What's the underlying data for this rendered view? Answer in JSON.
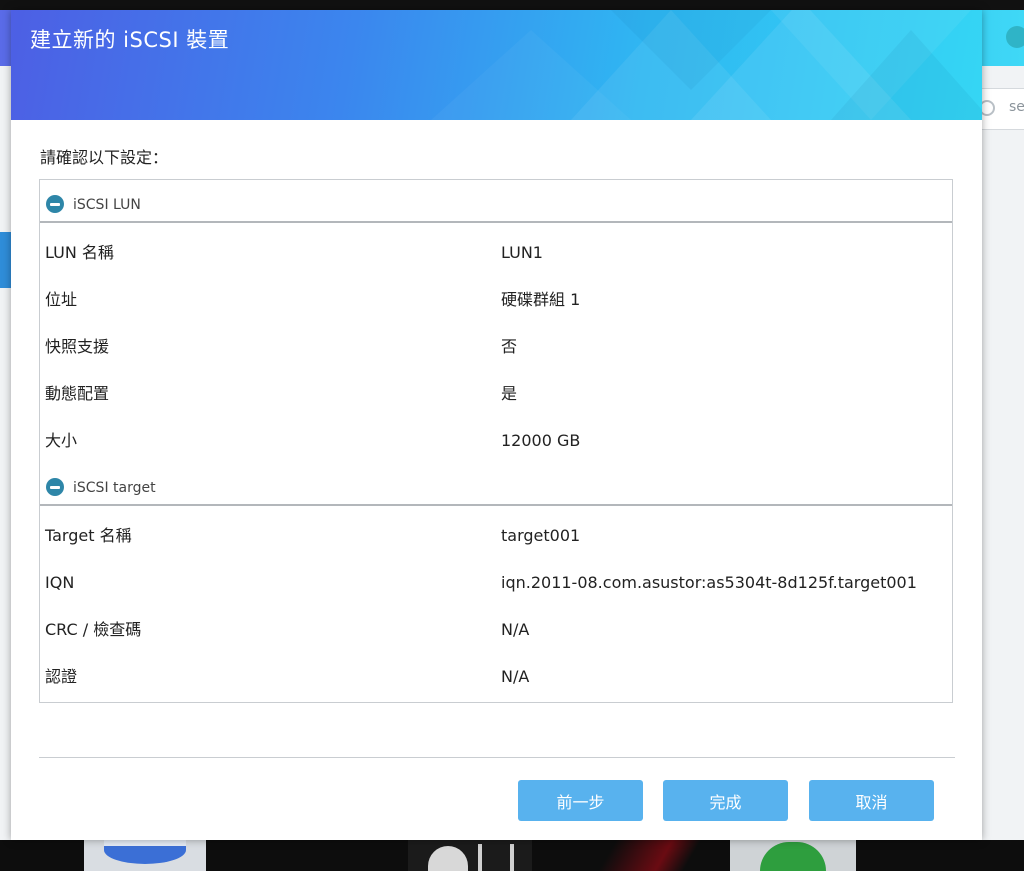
{
  "background_app": {
    "search_placeholder": "se"
  },
  "dialog": {
    "title": "建立新的 iSCSI 裝置",
    "confirm_label": "請確認以下設定：",
    "lun_section": {
      "title": "iSCSI LUN",
      "rows": [
        {
          "key": "LUN 名稱",
          "value": "LUN1"
        },
        {
          "key": "位址",
          "value": "硬碟群組 1"
        },
        {
          "key": "快照支援",
          "value": "否"
        },
        {
          "key": "動態配置",
          "value": "是"
        },
        {
          "key": "大小",
          "value": "12000 GB"
        }
      ]
    },
    "target_section": {
      "title": "iSCSI target",
      "rows": [
        {
          "key": "Target 名稱",
          "value": "target001"
        },
        {
          "key": "IQN",
          "value": "iqn.2011-08.com.asustor:as5304t-8d125f.target001"
        },
        {
          "key": "CRC / 檢查碼",
          "value": "N/A"
        },
        {
          "key": "認證",
          "value": "N/A"
        }
      ]
    },
    "buttons": {
      "prev": "前一步",
      "finish": "完成",
      "cancel": "取消"
    }
  },
  "colors": {
    "button": "#58b2ee",
    "header_start": "#4d5fe4",
    "header_end": "#35d6f4",
    "section_icon": "#2e86a8"
  }
}
